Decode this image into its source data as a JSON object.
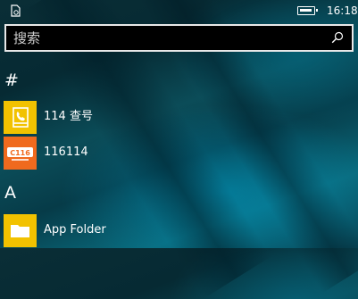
{
  "status_bar": {
    "time": "16:18"
  },
  "search": {
    "placeholder": "搜索"
  },
  "sections": [
    {
      "letter": "#",
      "apps": [
        {
          "name": "114 查号",
          "tile_color": "#f2c200",
          "icon": "phone-book-icon"
        },
        {
          "name": "116114",
          "tile_color": "#f06a1e",
          "icon": "116114-logo"
        }
      ]
    },
    {
      "letter": "A",
      "apps": [
        {
          "name": "App Folder",
          "tile_color": "#f2c200",
          "icon": "folder-icon"
        }
      ]
    }
  ],
  "colors": {
    "accent_yellow": "#f2c200",
    "accent_orange": "#f06a1e"
  }
}
